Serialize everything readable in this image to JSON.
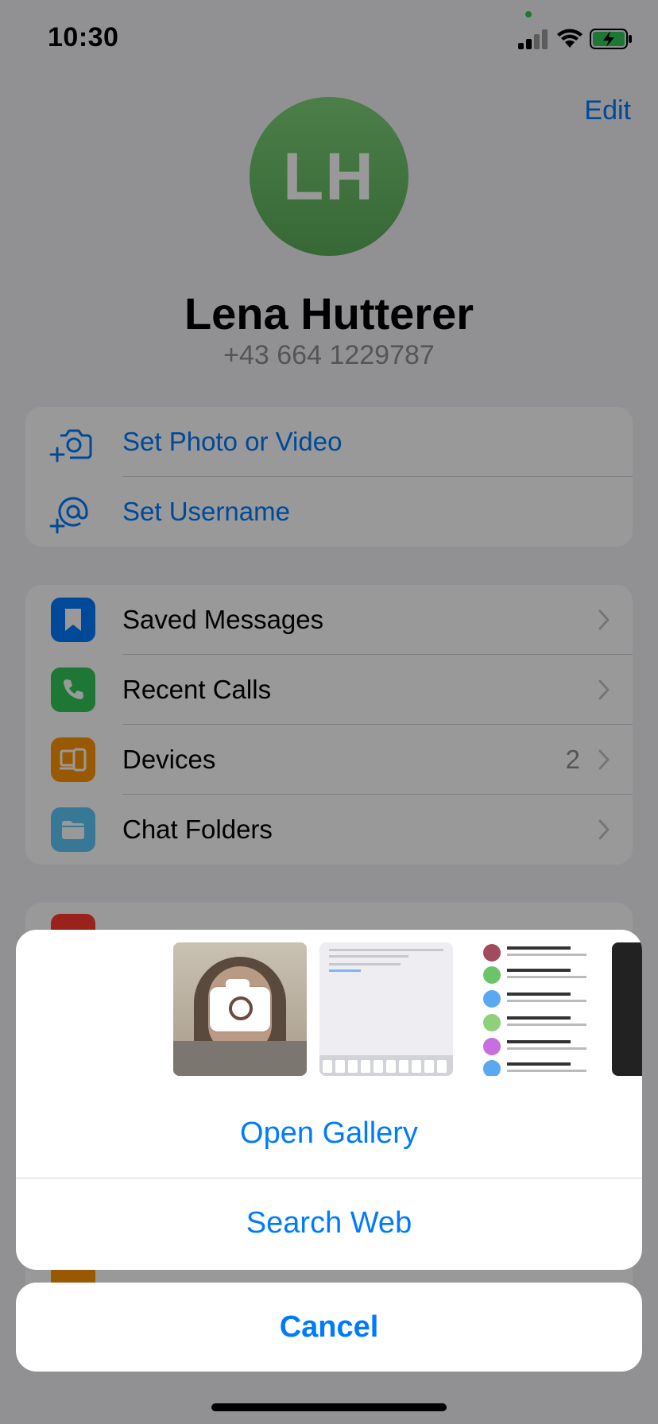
{
  "status_bar": {
    "time": "10:30"
  },
  "header": {
    "edit_label": "Edit"
  },
  "profile": {
    "initials": "LH",
    "name": "Lena Hutterer",
    "phone": "+43 664 1229787",
    "avatar_color": "#6cc46a"
  },
  "profile_actions": [
    {
      "label": "Set Photo or Video",
      "icon": "add-photo-icon"
    },
    {
      "label": "Set Username",
      "icon": "add-username-icon"
    }
  ],
  "menu": [
    {
      "label": "Saved Messages",
      "icon": "bookmark-icon",
      "color": "#007aff"
    },
    {
      "label": "Recent Calls",
      "icon": "phone-icon",
      "color": "#34c759"
    },
    {
      "label": "Devices",
      "icon": "devices-icon",
      "color": "#ff9500",
      "count": "2"
    },
    {
      "label": "Chat Folders",
      "icon": "folder-icon",
      "color": "#5ac8fa"
    }
  ],
  "action_sheet": {
    "gallery_label": "Open Gallery",
    "search_label": "Search Web",
    "cancel_label": "Cancel",
    "thumbnails": [
      "camera-preview",
      "screenshot-username",
      "screenshot-chat-list",
      "photo"
    ]
  }
}
